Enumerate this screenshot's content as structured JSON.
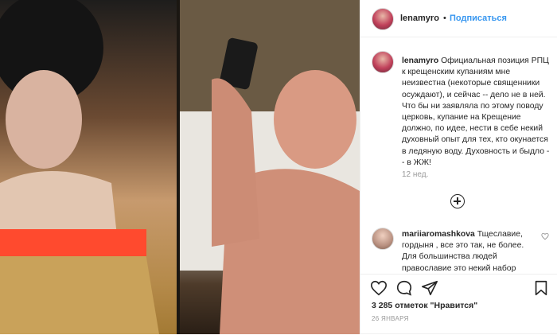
{
  "post": {
    "username": "lenamyro",
    "dot": "•",
    "follow_label": "Подписаться",
    "caption": "Официальная позиция РПЦ к крещенским купаниям мне неизвестна (некоторые священники осуждают), и сейчас -- дело не в ней. Что бы ни заявляла по этому поводу церковь, купание на Крещение должно, по идее, нести в себе некий духовный опыт для тех, кто окунается в ледяную воду. Духовность и быдло -- в ЖЖ!",
    "timestamp": "12 нед.",
    "comment": {
      "username": "mariiaromashkova",
      "text": "Тщеславие, гордыня , все это так, не более. Для большинства людей православие это некий набор"
    },
    "likes": "3 285 отметок \"Нравится\"",
    "date": "26 ЯНВАРЯ"
  },
  "icons": {
    "avatar": "avatar-icon",
    "load_more": "plus-circle-icon",
    "comment_like": "heart-icon",
    "like": "heart-icon",
    "comment": "comment-icon",
    "share": "share-icon",
    "save": "bookmark-icon"
  },
  "colors": {
    "link": "#3897f0",
    "text": "#262626",
    "muted": "#999999",
    "censor": "#ff4a2e"
  }
}
